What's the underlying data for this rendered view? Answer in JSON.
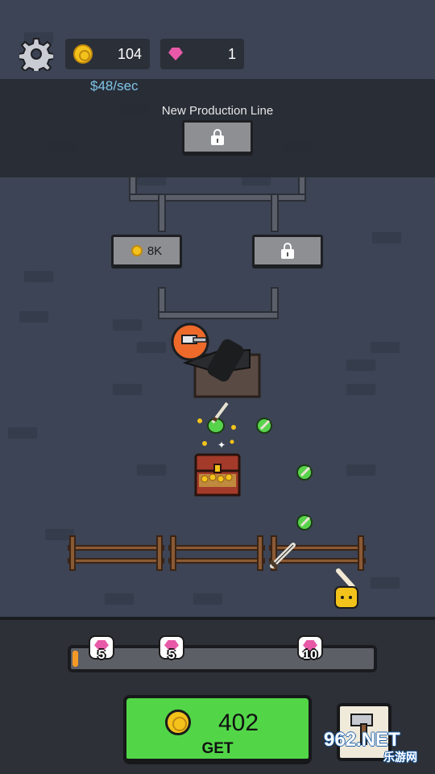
{
  "header": {
    "settings_icon": "gear-icon",
    "coins": "104",
    "gems": "1",
    "rate": "$48/sec"
  },
  "production": {
    "new_line_label": "New Production Line"
  },
  "upgrades": {
    "left_cost": "8K"
  },
  "progress": {
    "fraction": 0.02,
    "milestones": [
      "5",
      "5",
      "10"
    ]
  },
  "get_button": {
    "amount": "402",
    "label": "GET"
  },
  "watermark": {
    "text": "962.NET",
    "sub": "乐游网"
  },
  "colors": {
    "get_green": "#52d648",
    "coin_gold": "#f4c21b",
    "gem_pink": "#e85aa8",
    "progress_orange": "#f39a26",
    "rate_blue": "#7fc4e8"
  }
}
